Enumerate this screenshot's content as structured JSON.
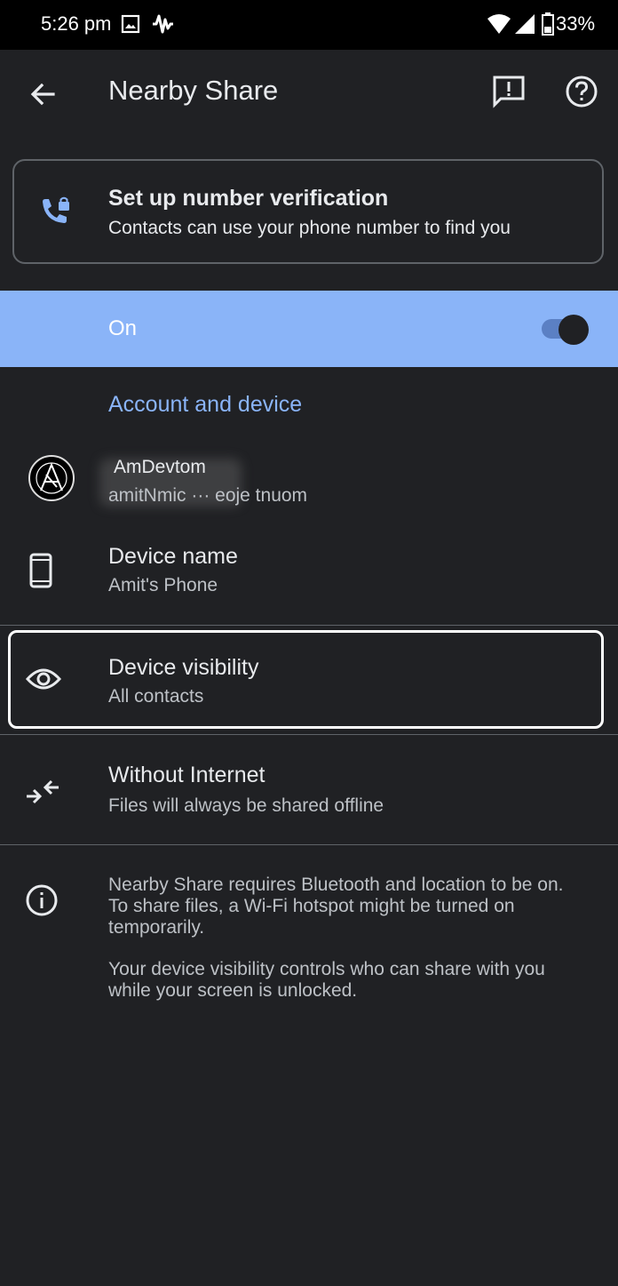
{
  "status_bar": {
    "time": "5:26 pm",
    "battery_percent": "33%"
  },
  "app_bar": {
    "title": "Nearby Share"
  },
  "verify_card": {
    "title": "Set up number verification",
    "subtitle": "Contacts can use your phone number to find you"
  },
  "toggle": {
    "label": "On",
    "state": "on"
  },
  "section": {
    "header": "Account and device"
  },
  "account": {
    "name": "AmDevtom",
    "email": "amitNmic ··· eoje tnuom"
  },
  "device_name": {
    "title": "Device name",
    "value": "Amit's Phone"
  },
  "device_visibility": {
    "title": "Device visibility",
    "value": "All contacts"
  },
  "without_internet": {
    "title": "Without Internet",
    "value": "Files will always be shared offline"
  },
  "info": {
    "paragraph1": "Nearby Share requires Bluetooth and location to be on. To share files, a Wi-Fi hotspot might be turned on temporarily.",
    "paragraph2": "Your device visibility controls who can share with you while your screen is unlocked."
  },
  "colors": {
    "background": "#202124",
    "accent": "#8ab4f8",
    "text": "#e8eaed"
  }
}
